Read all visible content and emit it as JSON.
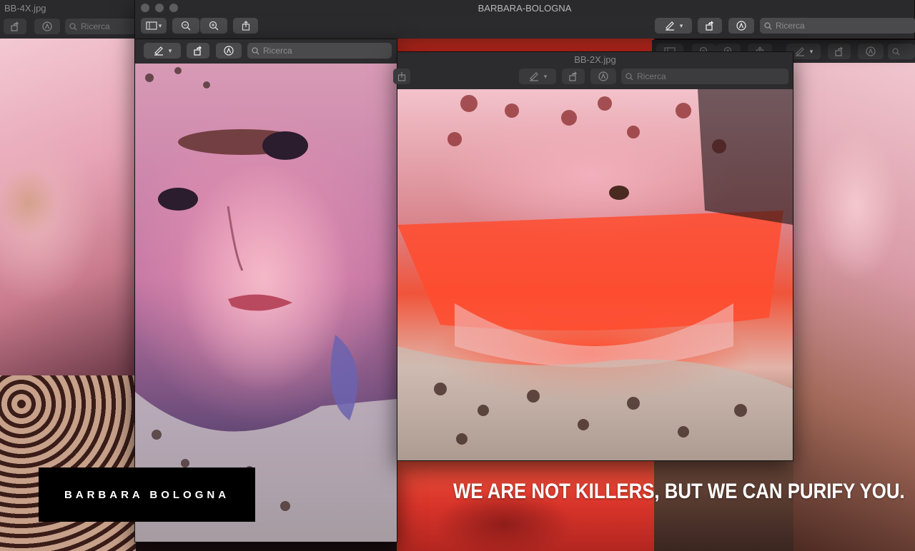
{
  "windows": {
    "main_title": "BARBARA-BOLOGNA",
    "left_window_title": "BB-4X.jpg",
    "inner_window_title": "BB-2X.jpg"
  },
  "search": {
    "label": "Ricerca"
  },
  "brand": {
    "name": "BARBARA BOLOGNA"
  },
  "slogan": {
    "text": "WE ARE NOT KILLERS, BUT WE CAN PURIFY YOU."
  },
  "icons": {
    "sidebar": "sidebar-icon",
    "zoom_out": "zoom-out-icon",
    "zoom_in": "zoom-in-icon",
    "share": "share-icon",
    "markup": "pen-icon",
    "rotate": "rotate-icon",
    "annotate": "markup-circle-icon",
    "search": "magnifier-icon"
  },
  "colors": {
    "chrome": "#2f2f31",
    "button": "#4a4a4c",
    "accent_red": "#ff3b2b"
  }
}
